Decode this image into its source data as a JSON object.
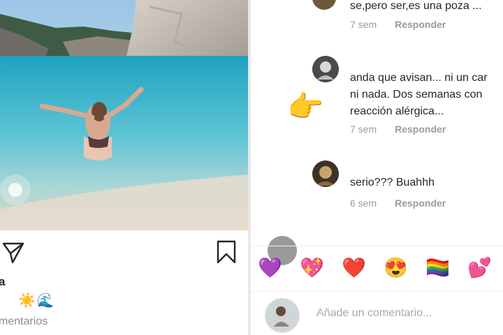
{
  "post": {
    "caption_user": "a",
    "caption_emoji": "☀️🌊",
    "comments_link": "mentarios"
  },
  "comments": [
    {
      "text_lines": [
        "se,pero ser,es una poza ..."
      ],
      "time": "7 sem",
      "reply": "Responder"
    },
    {
      "text_lines": [
        "anda que avisan... ni un car",
        "ni nada. Dos semanas con",
        "reacción alérgica..."
      ],
      "time": "7 sem",
      "reply": "Responder"
    },
    {
      "text_lines": [
        "serio??? Buahhh"
      ],
      "time": "6 sem",
      "reply": "Responder"
    }
  ],
  "pointing_emoji": "👉",
  "quick_reactions": [
    "💜",
    "💖",
    "❤️",
    "😍",
    "🏳️‍🌈",
    "💕"
  ],
  "add_comment": {
    "placeholder": "Añade un comentario..."
  },
  "colors": {
    "muted": "#8e8e8e",
    "water": "#5cc3d6",
    "text": "#262626"
  },
  "icons": [
    "share-icon",
    "bookmark-icon"
  ]
}
